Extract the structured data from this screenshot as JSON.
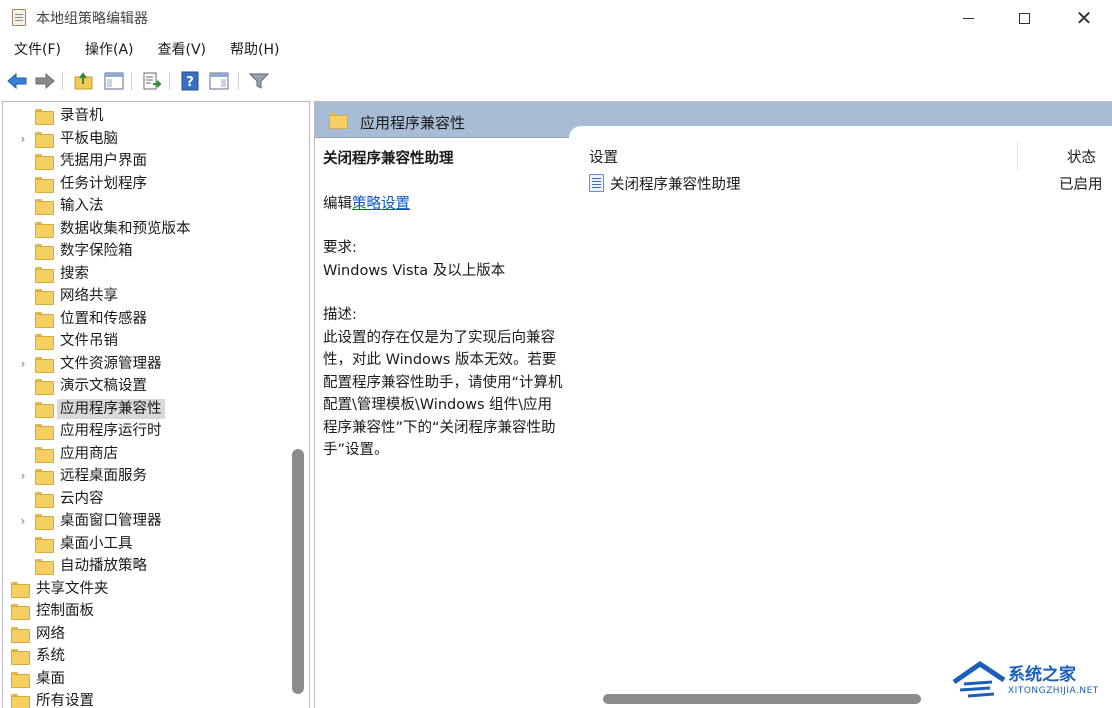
{
  "window": {
    "title": "本地组策略编辑器"
  },
  "menu": [
    "文件(F)",
    "操作(A)",
    "查看(V)",
    "帮助(H)"
  ],
  "tree": {
    "items": [
      {
        "label": "录音机",
        "depth": 1,
        "expandable": false
      },
      {
        "label": "平板电脑",
        "depth": 1,
        "expandable": true
      },
      {
        "label": "凭据用户界面",
        "depth": 1,
        "expandable": false
      },
      {
        "label": "任务计划程序",
        "depth": 1,
        "expandable": false
      },
      {
        "label": "输入法",
        "depth": 1,
        "expandable": false
      },
      {
        "label": "数据收集和预览版本",
        "depth": 1,
        "expandable": false
      },
      {
        "label": "数字保险箱",
        "depth": 1,
        "expandable": false
      },
      {
        "label": "搜索",
        "depth": 1,
        "expandable": false
      },
      {
        "label": "网络共享",
        "depth": 1,
        "expandable": false
      },
      {
        "label": "位置和传感器",
        "depth": 1,
        "expandable": false
      },
      {
        "label": "文件吊销",
        "depth": 1,
        "expandable": false
      },
      {
        "label": "文件资源管理器",
        "depth": 1,
        "expandable": true
      },
      {
        "label": "演示文稿设置",
        "depth": 1,
        "expandable": false
      },
      {
        "label": "应用程序兼容性",
        "depth": 1,
        "expandable": false,
        "selected": true
      },
      {
        "label": "应用程序运行时",
        "depth": 1,
        "expandable": false
      },
      {
        "label": "应用商店",
        "depth": 1,
        "expandable": false
      },
      {
        "label": "远程桌面服务",
        "depth": 1,
        "expandable": true
      },
      {
        "label": "云内容",
        "depth": 1,
        "expandable": false
      },
      {
        "label": "桌面窗口管理器",
        "depth": 1,
        "expandable": true
      },
      {
        "label": "桌面小工具",
        "depth": 1,
        "expandable": false
      },
      {
        "label": "自动播放策略",
        "depth": 1,
        "expandable": false
      },
      {
        "label": "共享文件夹",
        "depth": 0,
        "expandable": false
      },
      {
        "label": "控制面板",
        "depth": 0,
        "expandable": false
      },
      {
        "label": "网络",
        "depth": 0,
        "expandable": false
      },
      {
        "label": "系统",
        "depth": 0,
        "expandable": false
      },
      {
        "label": "桌面",
        "depth": 0,
        "expandable": false
      },
      {
        "label": "所有设置",
        "depth": 0,
        "expandable": false
      }
    ]
  },
  "right": {
    "header_title": "应用程序兼容性",
    "desc": {
      "title": "关闭程序兼容性助理",
      "edit_prefix": "编辑",
      "edit_link": "策略设置",
      "req_label": "要求:",
      "req_value": "Windows Vista 及以上版本",
      "desc_label": "描述:",
      "desc_lines": [
        "此设置的存在仅是为了实现后向兼容",
        "性，对此 Windows 版本无效。若要",
        "配置程序兼容性助手，请使用“计算机",
        "配置\\管理模板\\Windows 组件\\应用",
        "程序兼容性”下的“关闭程序兼容性助",
        "手”设置。"
      ]
    },
    "list": {
      "col_setting": "设置",
      "col_state": "状态",
      "rows": [
        {
          "name": "关闭程序兼容性助理",
          "state": "已启用"
        }
      ]
    }
  },
  "watermark": {
    "text": "系统之家",
    "sub": "XITONGZHIJIA.NET"
  }
}
